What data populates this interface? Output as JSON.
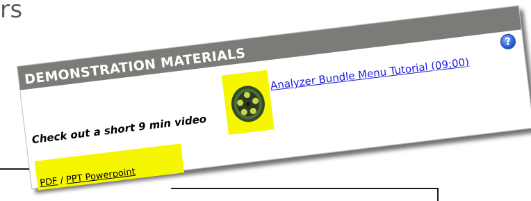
{
  "background_heading": "rs",
  "card": {
    "title": "DEMONSTRATION MATERIALS",
    "video_prompt": "Check out a short 9 min video",
    "video_link": "Analyzer Bundle Menu Tutorial (09:00)",
    "help_icon_glyph": "?",
    "docs": {
      "pdf_label": "PDF",
      "separator": " / ",
      "ppt_label": "PPT Powerpoint"
    }
  },
  "icons": {
    "film_reel": "film-reel-icon",
    "help": "help-icon"
  },
  "colors": {
    "header_bg": "#7b7b77",
    "header_text": "#ffffff",
    "highlight": "#f6f600",
    "link": "#1a1adb",
    "help_blue": "#2f63d9"
  }
}
